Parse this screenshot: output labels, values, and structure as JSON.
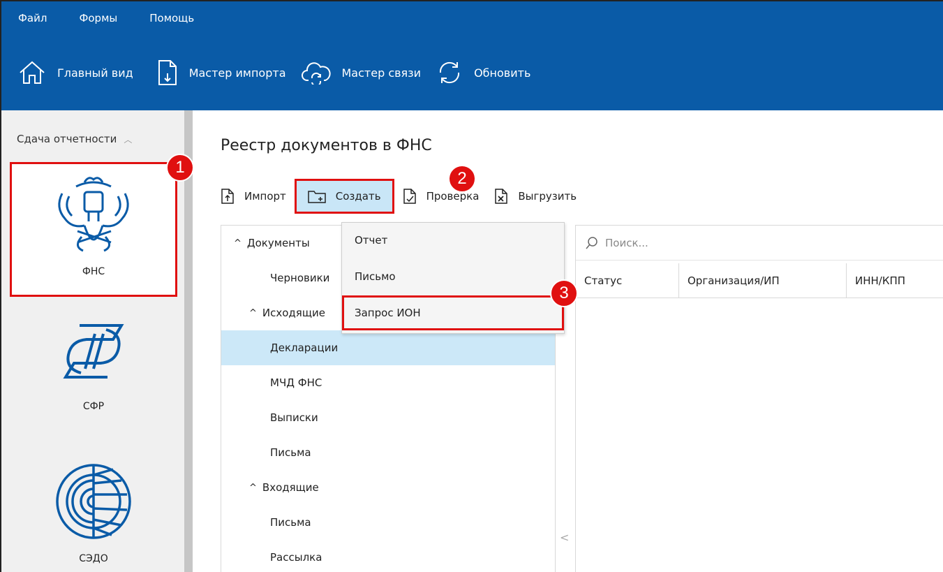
{
  "menu": [
    {
      "label": "Файл"
    },
    {
      "label": "Формы"
    },
    {
      "label": "Помощь"
    }
  ],
  "toolbar": {
    "home": "Главный вид",
    "import_wizard": "Мастер импорта",
    "link_wizard": "Мастер связи",
    "refresh": "Обновить"
  },
  "sidebar": {
    "header": "Сдача отчетности",
    "services": [
      {
        "label": "ФНС"
      },
      {
        "label": "СФР"
      },
      {
        "label": "СЭДО"
      }
    ]
  },
  "main": {
    "title": "Реестр документов в ФНС",
    "actions": {
      "import": "Импорт",
      "create": "Создать",
      "check": "Проверка",
      "export": "Выгрузить"
    }
  },
  "tree": [
    {
      "label": "Документы"
    },
    {
      "label": "Черновики"
    },
    {
      "label": "Исходящие"
    },
    {
      "label": "Декларации"
    },
    {
      "label": "МЧД ФНС"
    },
    {
      "label": "Выписки"
    },
    {
      "label": "Письма"
    },
    {
      "label": "Входящие"
    },
    {
      "label": "Письма"
    },
    {
      "label": "Рассылка"
    }
  ],
  "dropdown": [
    {
      "label": "Отчет"
    },
    {
      "label": "Письмо"
    },
    {
      "label": "Запрос ИОН"
    }
  ],
  "grid": {
    "search_placeholder": "Поиск...",
    "columns": [
      "Статус",
      "Организация/ИП",
      "ИНН/КПП"
    ]
  },
  "callouts": [
    "1",
    "2",
    "3"
  ],
  "colors": {
    "ribbon": "#0a5ba7",
    "highlight_border": "#e01010",
    "selected_row": "#cce8f8",
    "create_button_bg": "#c9e6f7"
  }
}
